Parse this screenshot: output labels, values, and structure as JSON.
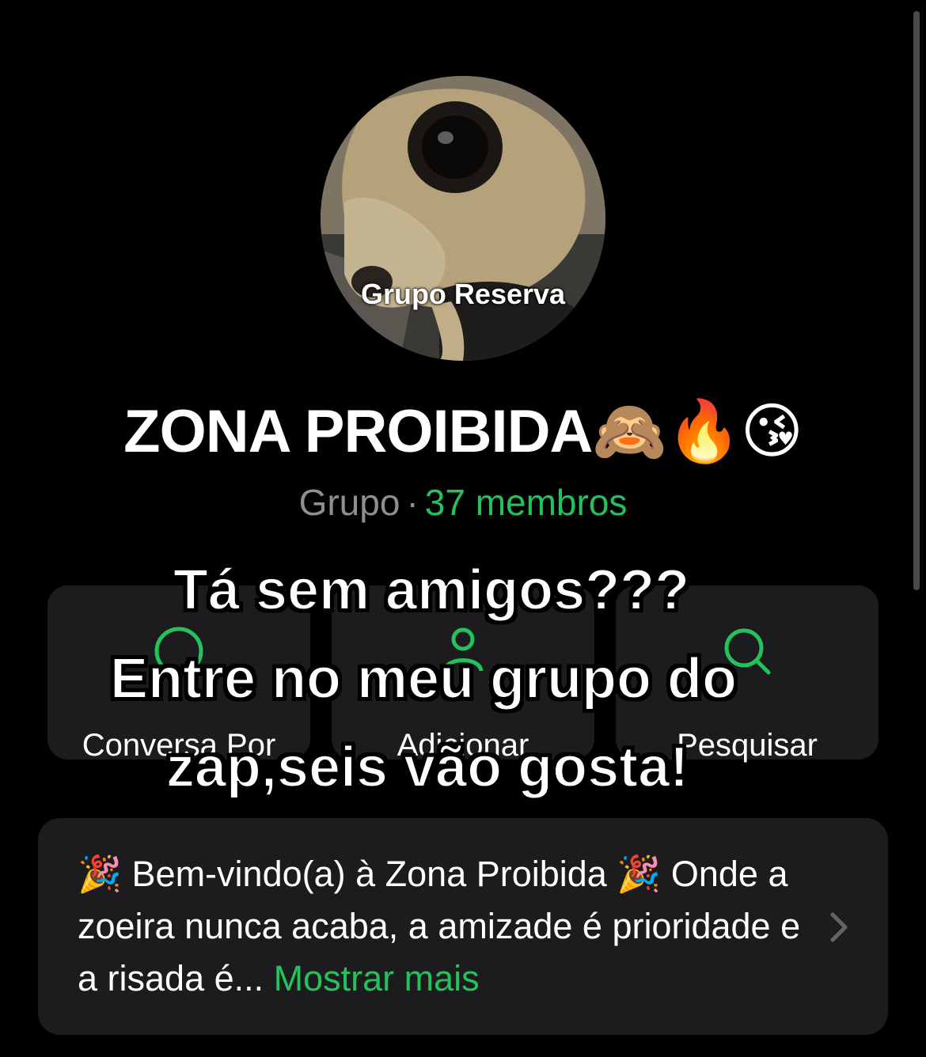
{
  "avatar": {
    "overlay_text": "Grupo Reserva"
  },
  "group": {
    "name": "ZONA PROIBIDA🙈🔥😘",
    "type_label": "Grupo",
    "separator": "·",
    "members_label": "37 membros"
  },
  "actions": [
    {
      "label": "Conversa Por",
      "icon": "phone-icon"
    },
    {
      "label": "Adicionar",
      "icon": "add-member-icon"
    },
    {
      "label": "Pesquisar",
      "icon": "search-icon"
    }
  ],
  "overlay_caption": {
    "line1": "Tá sem amigos???",
    "line2": "Entre no meu grupo do",
    "line3": "zap,seis vão gosta!"
  },
  "description": {
    "text": "🎉 Bem-vindo(a) à Zona Proibida 🎉 Onde a zoeira nunca acaba, a amizade é prioridade e a risada é...",
    "show_more": "Mostrar mais"
  },
  "colors": {
    "accent": "#25c15d",
    "background": "#000000",
    "card": "#1c1c1e",
    "secondary_text": "#8e8e93"
  }
}
